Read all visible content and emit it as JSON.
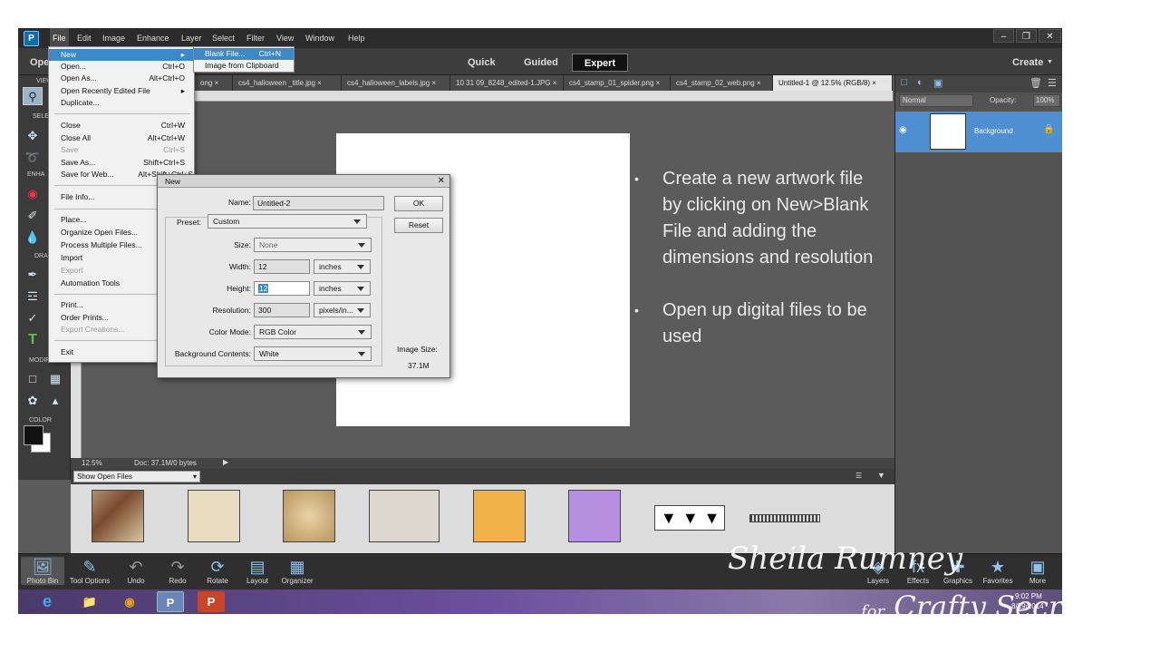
{
  "menubar": {
    "items": [
      "File",
      "Edit",
      "Image",
      "Enhance",
      "Layer",
      "Select",
      "Filter",
      "View",
      "Window",
      "Help"
    ]
  },
  "modebar": {
    "quick": "Quick",
    "guided": "Guided",
    "expert": "Expert",
    "create": "Create",
    "open_partial": "Ope"
  },
  "tabs": [
    "ong",
    "cs4_halloween _title.jpg",
    "cs4_halloween_labels.jpg",
    "10 31 09_8248_edited-1.JPG",
    "cs4_stamp_01_spider.png",
    "cs4_stamp_02_web.png",
    "Untitled-1 @ 12.5% (RGB/8)"
  ],
  "tabs_more": ">>",
  "toolpanel": {
    "view": "VIEW",
    "select": "SELE",
    "enhance": "ENHA",
    "draw": "DRA",
    "modify": "MODIF",
    "color": "COLOR"
  },
  "file_menu": {
    "new": "New",
    "open": "Open...",
    "open_sc": "Ctrl+O",
    "open_as": "Open As...",
    "open_as_sc": "Alt+Ctrl+O",
    "open_recent": "Open Recently Edited File",
    "duplicate": "Duplicate...",
    "close": "Close",
    "close_sc": "Ctrl+W",
    "close_all": "Close All",
    "close_all_sc": "Alt+Ctrl+W",
    "save": "Save",
    "save_sc": "Ctrl+S",
    "save_as": "Save As...",
    "save_as_sc": "Shift+Ctrl+S",
    "save_web": "Save for Web...",
    "save_web_sc": "Alt+Shift+Ctrl+S",
    "file_info": "File Info...",
    "place": "Place...",
    "organize": "Organize Open Files...",
    "process": "Process Multiple Files...",
    "import": "Import",
    "export": "Export",
    "automation": "Automation Tools",
    "print": "Print...",
    "order_prints": "Order Prints...",
    "export_creations": "Export Creations...",
    "exit": "Exit"
  },
  "new_submenu": {
    "blank": "Blank File...",
    "blank_sc": "Ctrl+N",
    "clipboard": "Image from Clipboard"
  },
  "new_dialog": {
    "title": "New",
    "name_label": "Name:",
    "name_value": "Untitled-2",
    "preset_label": "Preset:",
    "preset_value": "Custom",
    "size_label": "Size:",
    "size_value": "None",
    "width_label": "Width:",
    "width_value": "12",
    "width_unit": "inches",
    "height_label": "Height:",
    "height_value": "12",
    "height_unit": "inches",
    "resolution_label": "Resolution:",
    "resolution_value": "300",
    "resolution_unit": "pixels/in...",
    "color_mode_label": "Color Mode:",
    "color_mode_value": "RGB Color",
    "bg_label": "Background Contents:",
    "bg_value": "White",
    "ok": "OK",
    "reset": "Reset",
    "image_size_label": "Image Size:",
    "image_size_value": "37.1M"
  },
  "status": {
    "zoom": "12.5%",
    "doc": "Doc: 37.1M/0 bytes"
  },
  "bin": {
    "show_open": "Show Open Files"
  },
  "right_panel": {
    "blend_mode": "Normal",
    "opacity_label": "Opacity:",
    "opacity_value": "100%",
    "layer_name": "Background"
  },
  "bottom_bar": [
    "Photo Bin",
    "Tool Options",
    "Undo",
    "Redo",
    "Rotate",
    "Layout",
    "Organizer"
  ],
  "bottom_right": [
    "Layers",
    "Effects",
    "Graphics",
    "Favorites",
    "More"
  ],
  "taskbar": {
    "time": "9:02 PM",
    "date": "8/29/2014"
  },
  "notes": [
    "Create a new artwork file by clicking on New>Blank File and adding the dimensions and resolution",
    "Open up digital files to be used"
  ],
  "signature": {
    "line1": "Sheila Rumney",
    "line2_for": "for",
    "line2": "Crafty Secrets"
  },
  "colors": {
    "accent": "#3d88c6",
    "panel": "#3b3b3b",
    "work": "#5b5b5b"
  }
}
